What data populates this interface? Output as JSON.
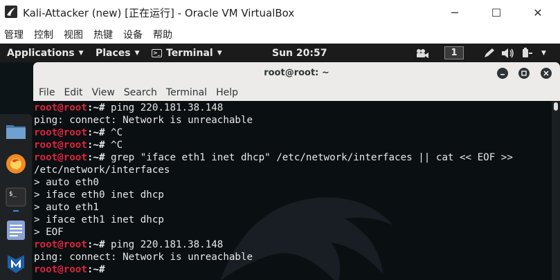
{
  "vbox": {
    "title": "Kali-Attacker (new) [正在运行] - Oracle VM VirtualBox",
    "menu": [
      "管理",
      "控制",
      "视图",
      "热键",
      "设备",
      "帮助"
    ],
    "controls": {
      "minimize": "─",
      "maximize": "☐",
      "close": "✕"
    }
  },
  "panel": {
    "applications": "Applications",
    "places": "Places",
    "terminal": "Terminal",
    "clock": "Sun 20:57",
    "workspace": "1"
  },
  "terminal": {
    "title": "root@root: ~",
    "menu": [
      "File",
      "Edit",
      "View",
      "Search",
      "Terminal",
      "Help"
    ],
    "lines": [
      {
        "prompt": "root@root",
        "sep": ":~# ",
        "text": "ping 220.181.38.148"
      },
      {
        "prompt": "",
        "sep": "",
        "text": "ping: connect: Network is unreachable"
      },
      {
        "prompt": "root@root",
        "sep": ":~# ",
        "text": "^C"
      },
      {
        "prompt": "root@root",
        "sep": ":~# ",
        "text": "^C"
      },
      {
        "prompt": "root@root",
        "sep": ":~# ",
        "text": "grep \"iface eth1 inet dhcp\" /etc/network/interfaces || cat << EOF >>"
      },
      {
        "prompt": "",
        "sep": "",
        "text": "/etc/network/interfaces"
      },
      {
        "prompt": "",
        "sep": "",
        "text": "> auto eth0"
      },
      {
        "prompt": "",
        "sep": "",
        "text": "> iface eth0 inet dhcp"
      },
      {
        "prompt": "",
        "sep": "",
        "text": "> auto eth1"
      },
      {
        "prompt": "",
        "sep": "",
        "text": "> iface eth1 inet dhcp"
      },
      {
        "prompt": "",
        "sep": "",
        "text": "> EOF"
      },
      {
        "prompt": "root@root",
        "sep": ":~# ",
        "text": "ping 220.181.38.148"
      },
      {
        "prompt": "",
        "sep": "",
        "text": "ping: connect: Network is unreachable"
      },
      {
        "prompt": "root@root",
        "sep": ":~# ",
        "text": ""
      }
    ]
  },
  "dock": [
    "files-icon",
    "firefox-icon",
    "terminal-icon",
    "text-editor-icon",
    "metasploit-icon"
  ],
  "colors": {
    "prompt": "#e0223f",
    "panel_bg": "#1b1b1b",
    "terminal_bg": "#0a0f12"
  }
}
